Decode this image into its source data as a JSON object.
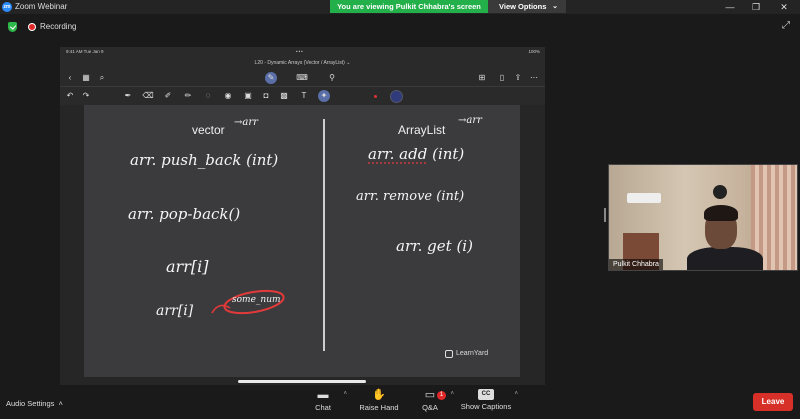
{
  "window": {
    "app_title": "Zoom Webinar",
    "logo_text": "zm",
    "share_banner": "You are viewing Pulkit Chhabra's screen",
    "view_options": "View Options",
    "minimize": "—",
    "restore": "❐",
    "close": "✕"
  },
  "recording": {
    "label": "Recording"
  },
  "ipad": {
    "status_time": "9:41 AM   Tue Jan 9",
    "status_dots": "•••",
    "status_battery": "100%",
    "doc_title": "L20 - Dynamic Arrays (Vector / ArrayList) ⌄"
  },
  "notes": {
    "left_heading": "vector",
    "left_annot": "→arr",
    "right_heading": "ArrayList",
    "right_annot": "→arr",
    "left_lines": [
      "arr. push_back (int)",
      "arr. pop-back()",
      "arr[i]",
      "arr[i]"
    ],
    "left_circled": "some_num",
    "right_lines": [
      "arr. add (int)",
      "arr. remove (int)",
      "arr. get (i)"
    ],
    "brand": "LearnYard"
  },
  "participant": {
    "name": "Pulkit Chhabra"
  },
  "bottombar": {
    "audio_settings": "Audio Settings",
    "chat": "Chat",
    "raise_hand": "Raise Hand",
    "qa": "Q&A",
    "qa_badge": "1",
    "captions": "Show Captions",
    "cc": "CC",
    "leave": "Leave"
  },
  "colors": {
    "share_banner": "#23b04a",
    "leave_button": "#d73028",
    "recording_dot": "#e02828",
    "circle_annotation": "#e23a3a",
    "underline_annotation": "#e23a3a",
    "page_bg": "#3b3a3c"
  }
}
